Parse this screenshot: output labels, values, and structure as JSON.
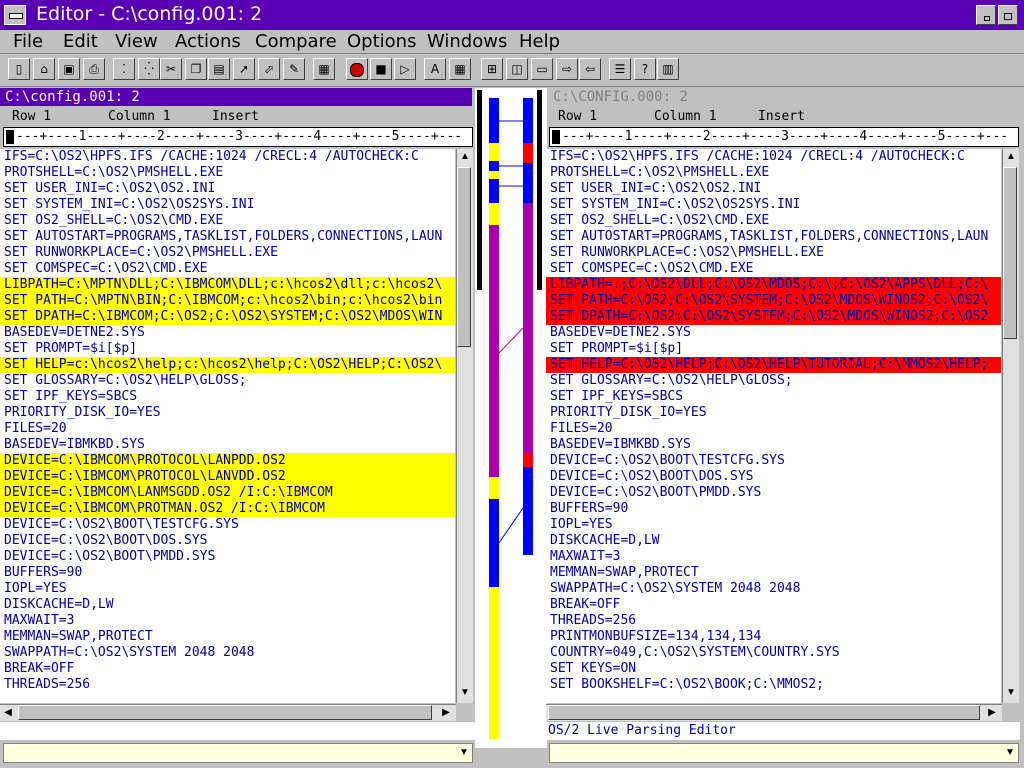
{
  "window": {
    "title": "Editor - C:\\config.001: 2"
  },
  "menu": [
    "File",
    "Edit",
    "View",
    "Actions",
    "Compare",
    "Options",
    "Windows",
    "Help"
  ],
  "toolbar": {
    "icons": [
      "new-file-icon",
      "open-folder-icon",
      "save-icon",
      "print-icon",
      "cut-dotted-icon",
      "copy-dotted-icon",
      "scissors-icon",
      "copy-icon",
      "paste-icon",
      "pointer-icon",
      "pointer-select-icon",
      "pen-icon",
      "calculator-icon",
      "record-icon",
      "stop-icon",
      "play-icon",
      "font-icon",
      "grid-icon",
      "tile-icon",
      "cascade-icon",
      "arrange-icon",
      "next-window-icon",
      "prev-window-icon",
      "notes-icon",
      "help-icon",
      "book-icon"
    ]
  },
  "left": {
    "title": "C:\\config.001: 2",
    "status": {
      "row": "Row 1",
      "column": "Column 1",
      "mode": "Insert"
    },
    "ruler": "---+----1----+----2----+----3----+----4----+----5----+---",
    "lines": [
      {
        "t": "IFS=C:\\OS2\\HPFS.IFS /CACHE:1024 /CRECL:4 /AUTOCHECK:C",
        "h": ""
      },
      {
        "t": "PROTSHELL=C:\\OS2\\PMSHELL.EXE",
        "h": ""
      },
      {
        "t": "SET USER_INI=C:\\OS2\\OS2.INI",
        "h": ""
      },
      {
        "t": "SET SYSTEM_INI=C:\\OS2\\OS2SYS.INI",
        "h": ""
      },
      {
        "t": "SET OS2_SHELL=C:\\OS2\\CMD.EXE",
        "h": ""
      },
      {
        "t": "SET AUTOSTART=PROGRAMS,TASKLIST,FOLDERS,CONNECTIONS,LAUN",
        "h": ""
      },
      {
        "t": "SET RUNWORKPLACE=C:\\OS2\\PMSHELL.EXE",
        "h": ""
      },
      {
        "t": "SET COMSPEC=C:\\OS2\\CMD.EXE",
        "h": ""
      },
      {
        "t": "LIBPATH=C:\\MPTN\\DLL;C:\\IBMCOM\\DLL;c:\\hcos2\\dll;c:\\hcos2\\",
        "h": "yellow"
      },
      {
        "t": "SET PATH=C:\\MPTN\\BIN;C:\\IBMCOM;c:\\hcos2\\bin;c:\\hcos2\\bin",
        "h": "yellow"
      },
      {
        "t": "SET DPATH=C:\\IBMCOM;C:\\OS2;C:\\OS2\\SYSTEM;C:\\OS2\\MDOS\\WIN",
        "h": "yellow"
      },
      {
        "t": "BASEDEV=DETNE2.SYS",
        "h": ""
      },
      {
        "t": "SET PROMPT=$i[$p]",
        "h": ""
      },
      {
        "t": "SET HELP=c:\\hcos2\\help;c:\\hcos2\\help;C:\\OS2\\HELP;C:\\OS2\\",
        "h": "yellow"
      },
      {
        "t": "SET GLOSSARY=C:\\OS2\\HELP\\GLOSS;",
        "h": ""
      },
      {
        "t": "SET IPF_KEYS=SBCS",
        "h": ""
      },
      {
        "t": "PRIORITY_DISK_IO=YES",
        "h": ""
      },
      {
        "t": "FILES=20",
        "h": ""
      },
      {
        "t": "BASEDEV=IBMKBD.SYS",
        "h": ""
      },
      {
        "t": "DEVICE=C:\\IBMCOM\\PROTOCOL\\LANPDD.OS2",
        "h": "yellow"
      },
      {
        "t": "DEVICE=C:\\IBMCOM\\PROTOCOL\\LANVDD.OS2",
        "h": "yellow"
      },
      {
        "t": "DEVICE=C:\\IBMCOM\\LANMSGDD.OS2 /I:C:\\IBMCOM",
        "h": "yellow"
      },
      {
        "t": "DEVICE=C:\\IBMCOM\\PROTMAN.OS2 /I:C:\\IBMCOM",
        "h": "yellow"
      },
      {
        "t": "DEVICE=C:\\OS2\\BOOT\\TESTCFG.SYS",
        "h": ""
      },
      {
        "t": "DEVICE=C:\\OS2\\BOOT\\DOS.SYS",
        "h": ""
      },
      {
        "t": "DEVICE=C:\\OS2\\BOOT\\PMDD.SYS",
        "h": ""
      },
      {
        "t": "BUFFERS=90",
        "h": ""
      },
      {
        "t": "IOPL=YES",
        "h": ""
      },
      {
        "t": "DISKCACHE=D,LW",
        "h": ""
      },
      {
        "t": "MAXWAIT=3",
        "h": ""
      },
      {
        "t": "MEMMAN=SWAP,PROTECT",
        "h": ""
      },
      {
        "t": "SWAPPATH=C:\\OS2\\SYSTEM 2048 2048",
        "h": ""
      },
      {
        "t": "BREAK=OFF",
        "h": ""
      },
      {
        "t": "THREADS=256",
        "h": ""
      }
    ]
  },
  "right": {
    "title": "C:\\CONFIG.000: 2",
    "status": {
      "row": "Row 1",
      "column": "Column 1",
      "mode": "Insert"
    },
    "ruler": "---+----1----+----2----+----3----+----4----+----5----+---",
    "lines": [
      {
        "t": "IFS=C:\\OS2\\HPFS.IFS /CACHE:1024 /CRECL:4 /AUTOCHECK:C",
        "h": ""
      },
      {
        "t": "PROTSHELL=C:\\OS2\\PMSHELL.EXE",
        "h": ""
      },
      {
        "t": "SET USER_INI=C:\\OS2\\OS2.INI",
        "h": ""
      },
      {
        "t": "SET SYSTEM_INI=C:\\OS2\\OS2SYS.INI",
        "h": ""
      },
      {
        "t": "SET OS2_SHELL=C:\\OS2\\CMD.EXE",
        "h": ""
      },
      {
        "t": "SET AUTOSTART=PROGRAMS,TASKLIST,FOLDERS,CONNECTIONS,LAUN",
        "h": ""
      },
      {
        "t": "SET RUNWORKPLACE=C:\\OS2\\PMSHELL.EXE",
        "h": ""
      },
      {
        "t": "SET COMSPEC=C:\\OS2\\CMD.EXE",
        "h": ""
      },
      {
        "t": "LIBPATH=.;C:\\OS2\\DLL;C:\\OS2\\MDOS;C:\\;C:\\OS2\\APPS\\DLL;C:\\",
        "h": "red"
      },
      {
        "t": "SET PATH=C:\\OS2;C:\\OS2\\SYSTEM;C:\\OS2\\MDOS\\WINOS2;C:\\OS2\\",
        "h": "red"
      },
      {
        "t": "SET DPATH=C:\\OS2;C:\\OS2\\SYSTEM;C:\\OS2\\MDOS\\WINOS2;C:\\OS2",
        "h": "red"
      },
      {
        "t": "BASEDEV=DETNE2.SYS",
        "h": ""
      },
      {
        "t": "SET PROMPT=$i[$p]",
        "h": ""
      },
      {
        "t": "SET HELP=C:\\OS2\\HELP;C:\\OS2\\HELP\\TUTORIAL;C:\\MMOS2\\HELP;",
        "h": "red"
      },
      {
        "t": "SET GLOSSARY=C:\\OS2\\HELP\\GLOSS;",
        "h": ""
      },
      {
        "t": "SET IPF_KEYS=SBCS",
        "h": ""
      },
      {
        "t": "PRIORITY_DISK_IO=YES",
        "h": ""
      },
      {
        "t": "FILES=20",
        "h": ""
      },
      {
        "t": "BASEDEV=IBMKBD.SYS",
        "h": ""
      },
      {
        "t": "DEVICE=C:\\OS2\\BOOT\\TESTCFG.SYS",
        "h": ""
      },
      {
        "t": "DEVICE=C:\\OS2\\BOOT\\DOS.SYS",
        "h": ""
      },
      {
        "t": "DEVICE=C:\\OS2\\BOOT\\PMDD.SYS",
        "h": ""
      },
      {
        "t": "BUFFERS=90",
        "h": ""
      },
      {
        "t": "IOPL=YES",
        "h": ""
      },
      {
        "t": "DISKCACHE=D,LW",
        "h": ""
      },
      {
        "t": "MAXWAIT=3",
        "h": ""
      },
      {
        "t": "MEMMAN=SWAP,PROTECT",
        "h": ""
      },
      {
        "t": "SWAPPATH=C:\\OS2\\SYSTEM 2048 2048",
        "h": ""
      },
      {
        "t": "BREAK=OFF",
        "h": ""
      },
      {
        "t": "THREADS=256",
        "h": ""
      },
      {
        "t": "PRINTMONBUFSIZE=134,134,134",
        "h": ""
      },
      {
        "t": "COUNTRY=049,C:\\OS2\\SYSTEM\\COUNTRY.SYS",
        "h": ""
      },
      {
        "t": "SET KEYS=ON",
        "h": ""
      },
      {
        "t": "SET BOOKSHELF=C:\\OS2\\BOOK;C:\\MMOS2;",
        "h": ""
      }
    ],
    "message": "OS/2 Live Parsing Editor"
  },
  "colors": {
    "accent": "#5a00b4",
    "text": "#0000a0",
    "changed_left": "#ffff00",
    "changed_right": "#ff0000",
    "map_same": "#aa00aa",
    "map_block": "#0000ff"
  }
}
